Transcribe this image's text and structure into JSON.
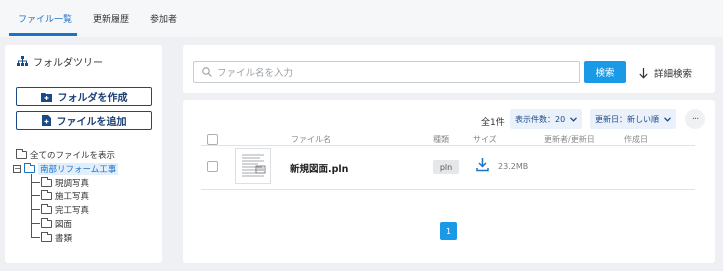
{
  "tabs": [
    {
      "label": "ファイル一覧",
      "active": true
    },
    {
      "label": "更新履歴",
      "active": false
    },
    {
      "label": "参加者",
      "active": false
    }
  ],
  "sidebar": {
    "title": "フォルダツリー",
    "create_folder_label": "フォルダを作成",
    "add_file_label": "ファイルを追加",
    "tree": {
      "all_files": "全てのファイルを表示",
      "root": "南部リフォーム工事",
      "children": [
        "現調写真",
        "施工写真",
        "完工写真",
        "図面",
        "書類"
      ]
    }
  },
  "search": {
    "placeholder": "ファイル名を入力",
    "button_label": "検索",
    "advanced_label": "詳細検索"
  },
  "list": {
    "count_label": "全1件",
    "per_page_label": "表示件数：20",
    "sort_label": "更新日：新しい順",
    "more_label": "···",
    "columns": {
      "name": "ファイル名",
      "type": "種類",
      "size": "サイズ",
      "updater": "更新者/更新日",
      "creator": "作成日"
    },
    "rows": [
      {
        "name": "新規図面.pln",
        "type": "pln",
        "size": "23.2MB"
      }
    ],
    "pagination": {
      "current_page": "1"
    }
  },
  "colors": {
    "accent": "#1a73c9",
    "primary_button": "#1a9ae6",
    "dark_blue": "#1a4a86"
  }
}
